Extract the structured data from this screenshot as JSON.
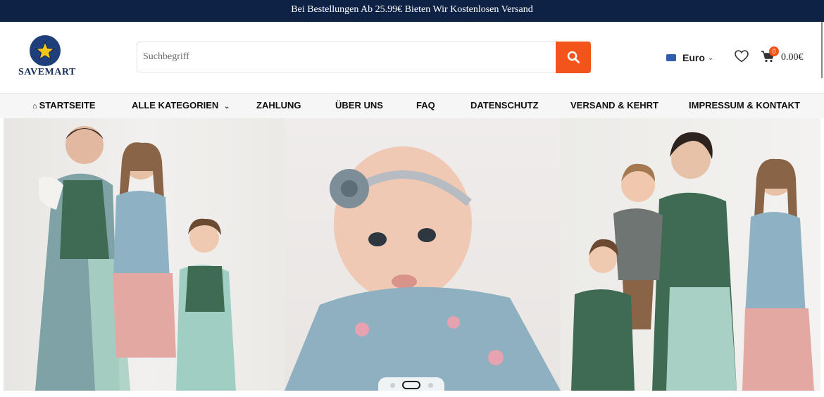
{
  "topbar": {
    "text": "Bei Bestellungen Ab 25.99€ Bieten Wir Kostenlosen Versand"
  },
  "brand": {
    "name": "SAVEMART"
  },
  "search": {
    "placeholder": "Suchbegriff"
  },
  "currency": {
    "label": "Euro"
  },
  "cart": {
    "count": "0",
    "total": "0.00€"
  },
  "nav": {
    "home": "STARTSEITE",
    "categories": "ALLE KATEGORIEN",
    "payment": "ZAHLUNG",
    "about": "ÜBER UNS",
    "faq": "FAQ",
    "privacy": "DATENSCHUTZ",
    "shipping": "VERSAND & KEHRT",
    "imprint": "IMPRESSUM & KONTAKT"
  },
  "slider": {
    "slide_count": 3,
    "active_slide": 2
  },
  "colors": {
    "topbar": "#0e2245",
    "accent": "#f2541b",
    "brand": "#1f3f7a"
  }
}
